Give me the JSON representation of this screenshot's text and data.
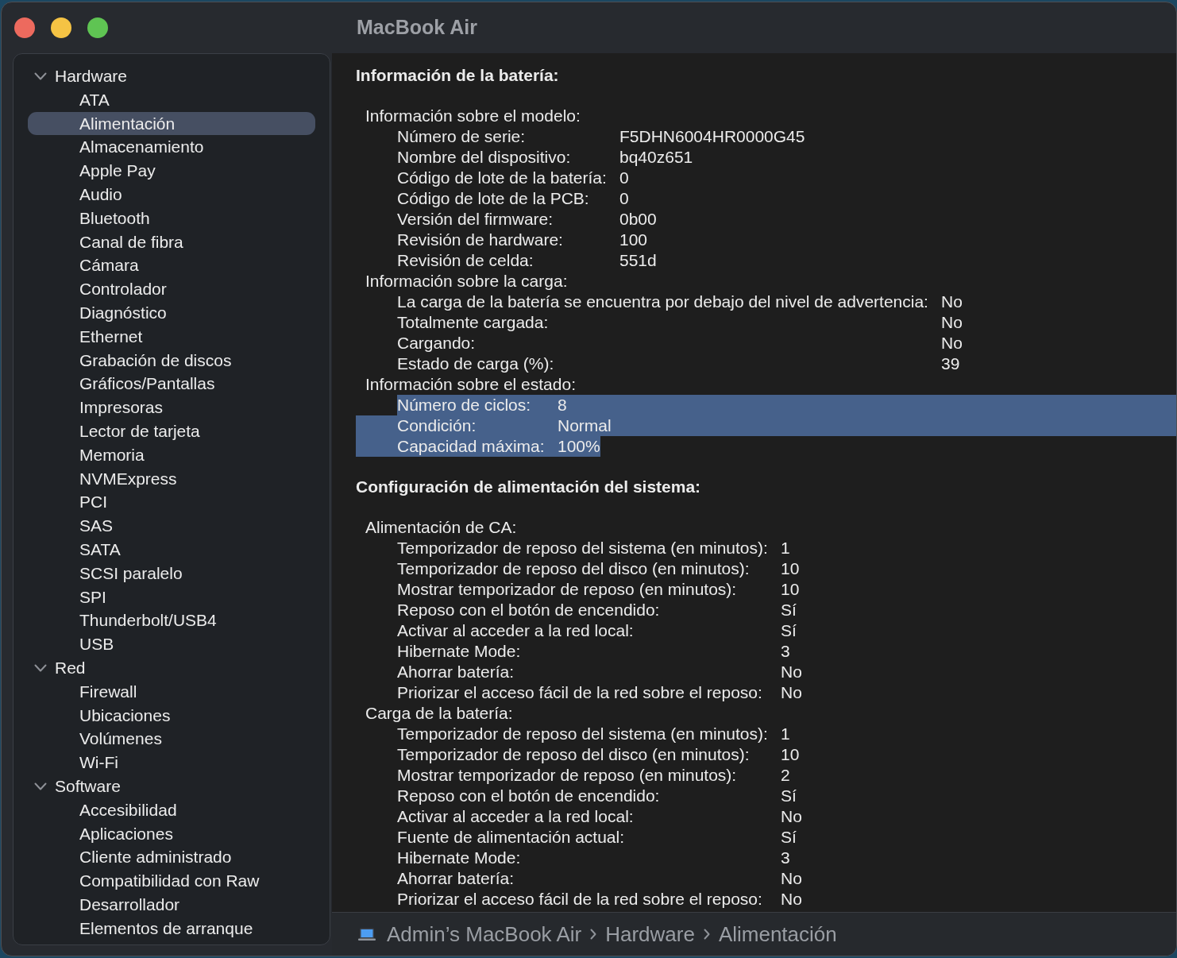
{
  "window": {
    "title": "MacBook Air"
  },
  "sidebar": {
    "groups": [
      {
        "label": "Hardware",
        "expanded": true,
        "items": [
          {
            "label": "ATA",
            "selected": false
          },
          {
            "label": "Alimentación",
            "selected": true
          },
          {
            "label": "Almacenamiento",
            "selected": false
          },
          {
            "label": "Apple Pay",
            "selected": false
          },
          {
            "label": "Audio",
            "selected": false
          },
          {
            "label": "Bluetooth",
            "selected": false
          },
          {
            "label": "Canal de fibra",
            "selected": false
          },
          {
            "label": "Cámara",
            "selected": false
          },
          {
            "label": "Controlador",
            "selected": false
          },
          {
            "label": "Diagnóstico",
            "selected": false
          },
          {
            "label": "Ethernet",
            "selected": false
          },
          {
            "label": "Grabación de discos",
            "selected": false
          },
          {
            "label": "Gráficos/Pantallas",
            "selected": false
          },
          {
            "label": "Impresoras",
            "selected": false
          },
          {
            "label": "Lector de tarjeta",
            "selected": false
          },
          {
            "label": "Memoria",
            "selected": false
          },
          {
            "label": "NVMExpress",
            "selected": false
          },
          {
            "label": "PCI",
            "selected": false
          },
          {
            "label": "SAS",
            "selected": false
          },
          {
            "label": "SATA",
            "selected": false
          },
          {
            "label": "SCSI paralelo",
            "selected": false
          },
          {
            "label": "SPI",
            "selected": false
          },
          {
            "label": "Thunderbolt/USB4",
            "selected": false
          },
          {
            "label": "USB",
            "selected": false
          }
        ]
      },
      {
        "label": "Red",
        "expanded": true,
        "items": [
          {
            "label": "Firewall",
            "selected": false
          },
          {
            "label": "Ubicaciones",
            "selected": false
          },
          {
            "label": "Volúmenes",
            "selected": false
          },
          {
            "label": "Wi-Fi",
            "selected": false
          }
        ]
      },
      {
        "label": "Software",
        "expanded": true,
        "items": [
          {
            "label": "Accesibilidad",
            "selected": false
          },
          {
            "label": "Aplicaciones",
            "selected": false
          },
          {
            "label": "Cliente administrado",
            "selected": false
          },
          {
            "label": "Compatibilidad con Raw",
            "selected": false
          },
          {
            "label": "Desarrollador",
            "selected": false
          },
          {
            "label": "Elementos de arranque",
            "selected": false
          }
        ]
      }
    ]
  },
  "sections": [
    {
      "title": "Información de la batería:",
      "groups": [
        {
          "label": "Información sobre el modelo:",
          "rows": [
            {
              "label": "Número de serie:",
              "value": "F5DHN6004HR0000G45",
              "selected": false
            },
            {
              "label": "Nombre del dispositivo:",
              "value": "bq40z651",
              "selected": false
            },
            {
              "label": "Código de lote de la batería:",
              "value": "0",
              "selected": false
            },
            {
              "label": "Código de lote de la PCB:",
              "value": "0",
              "selected": false
            },
            {
              "label": "Versión del firmware:",
              "value": "0b00",
              "selected": false
            },
            {
              "label": "Revisión de hardware:",
              "value": "100",
              "selected": false
            },
            {
              "label": "Revisión de celda:",
              "value": "551d",
              "selected": false
            }
          ]
        },
        {
          "label": "Información sobre la carga:",
          "rows": [
            {
              "label": "La carga de la batería se encuentra por debajo del nivel de advertencia:",
              "value": "No",
              "selected": false
            },
            {
              "label": "Totalmente cargada:",
              "value": "No",
              "selected": false
            },
            {
              "label": "Cargando:",
              "value": "No",
              "selected": false
            },
            {
              "label": "Estado de carga (%):",
              "value": "39",
              "selected": false
            }
          ]
        },
        {
          "label": "Información sobre el estado:",
          "rows": [
            {
              "label": "Número de ciclos:",
              "value": "8",
              "selected": true
            },
            {
              "label": "Condición:",
              "value": "Normal",
              "selected": true
            },
            {
              "label": "Capacidad máxima:",
              "value": "100%",
              "selected": true
            }
          ]
        }
      ]
    },
    {
      "title": "Configuración de alimentación del sistema:",
      "groups": [
        {
          "label": "Alimentación de CA:",
          "rows": [
            {
              "label": "Temporizador de reposo del sistema (en minutos):",
              "value": "1",
              "selected": false
            },
            {
              "label": "Temporizador de reposo del disco (en minutos):",
              "value": "10",
              "selected": false
            },
            {
              "label": "Mostrar temporizador de reposo (en minutos):",
              "value": "10",
              "selected": false
            },
            {
              "label": "Reposo con el botón de encendido:",
              "value": "Sí",
              "selected": false
            },
            {
              "label": "Activar al acceder a la red local:",
              "value": "Sí",
              "selected": false
            },
            {
              "label": "Hibernate Mode:",
              "value": "3",
              "selected": false
            },
            {
              "label": "Ahorrar batería:",
              "value": "No",
              "selected": false
            },
            {
              "label": "Priorizar el acceso fácil de la red sobre el reposo:",
              "value": "No",
              "selected": false
            }
          ]
        },
        {
          "label": "Carga de la batería:",
          "rows": [
            {
              "label": "Temporizador de reposo del sistema (en minutos):",
              "value": "1",
              "selected": false
            },
            {
              "label": "Temporizador de reposo del disco (en minutos):",
              "value": "10",
              "selected": false
            },
            {
              "label": "Mostrar temporizador de reposo (en minutos):",
              "value": "2",
              "selected": false
            },
            {
              "label": "Reposo con el botón de encendido:",
              "value": "Sí",
              "selected": false
            },
            {
              "label": "Activar al acceder a la red local:",
              "value": "No",
              "selected": false
            },
            {
              "label": "Fuente de alimentación actual:",
              "value": "Sí",
              "selected": false
            },
            {
              "label": "Hibernate Mode:",
              "value": "3",
              "selected": false
            },
            {
              "label": "Ahorrar batería:",
              "value": "No",
              "selected": false
            },
            {
              "label": "Priorizar el acceso fácil de la red sobre el reposo:",
              "value": "No",
              "selected": false
            }
          ]
        }
      ]
    }
  ],
  "path_bar": {
    "items": [
      "Admin’s MacBook Air",
      "Hardware",
      "Alimentación"
    ]
  }
}
